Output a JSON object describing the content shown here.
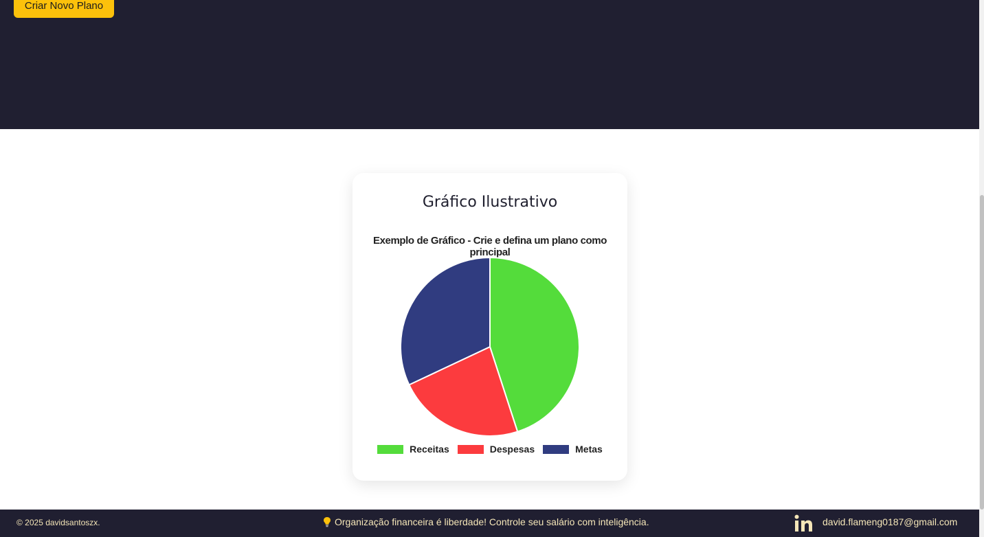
{
  "header": {
    "create_plan_button": "Criar Novo Plano"
  },
  "card": {
    "title": "Gráfico Ilustrativo"
  },
  "chart_data": {
    "type": "pie",
    "title": "Exemplo de Gráfico - Crie e defina um plano como principal",
    "categories": [
      "Receitas",
      "Despesas",
      "Metas"
    ],
    "values": [
      45,
      23,
      32
    ],
    "colors": [
      "#54dc3b",
      "#fc3b3e",
      "#303c80"
    ],
    "legend_placement": "bottom"
  },
  "footer": {
    "copyright": "© 2025 davidsantoszx.",
    "tagline": "Organização financeira é liberdade! Controle seu salário com inteligência.",
    "email": "david.flameng0187@gmail.com"
  },
  "icons": {
    "linkedin": "linkedin-icon",
    "bulb": "lightbulb-icon"
  }
}
